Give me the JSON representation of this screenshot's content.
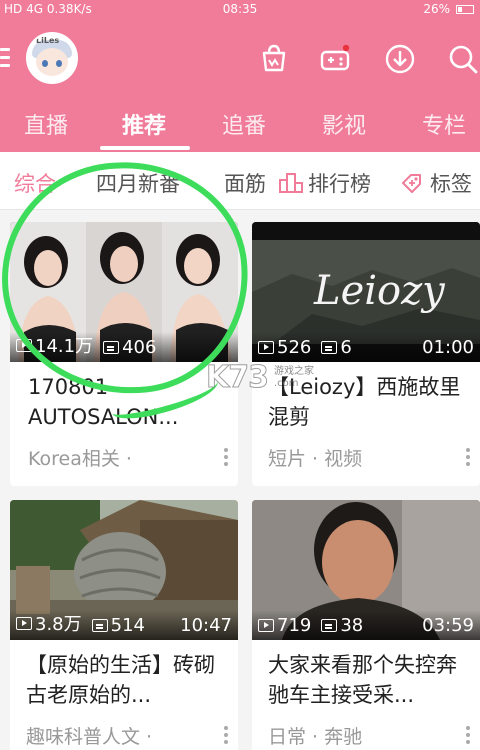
{
  "status_bar": {
    "signal": "HD 4G",
    "speed": "0.38K/s",
    "time": "08:35",
    "battery": "26%"
  },
  "header": {
    "avatar_label": "LiLes",
    "icons": [
      "shop-bag-icon",
      "game-icon",
      "download-icon",
      "search-icon"
    ],
    "accent": "#f07c9a"
  },
  "tabs": [
    {
      "label": "直播",
      "active": false
    },
    {
      "label": "推荐",
      "active": true
    },
    {
      "label": "追番",
      "active": false
    },
    {
      "label": "影视",
      "active": false
    },
    {
      "label": "专栏",
      "active": false
    }
  ],
  "subnav": [
    {
      "label": "综合",
      "active": true
    },
    {
      "label": "四月新番",
      "active": false
    },
    {
      "label": "面筋",
      "active": false
    },
    {
      "label": "排行榜",
      "active": false
    },
    {
      "label": "标签",
      "active": false
    }
  ],
  "videos": [
    {
      "views": "14.1万",
      "danmaku": "406",
      "duration": "",
      "title": "170801 AUTOSALON...",
      "meta": "Korea相关 ·"
    },
    {
      "views": "526",
      "danmaku": "6",
      "duration": "01:00",
      "title": "【Leiozy】西施故里混剪",
      "meta": "短片 · 视频",
      "thumb_text": "Leiozy"
    },
    {
      "views": "3.8万",
      "danmaku": "514",
      "duration": "10:47",
      "title": "【原始的生活】砖砌古老原始的...",
      "meta": "趣味科普人文 ·"
    },
    {
      "views": "719",
      "danmaku": "38",
      "duration": "03:59",
      "title": "大家来看那个失控奔驰车主接受采...",
      "meta": "日常 · 奔驰"
    }
  ],
  "watermark": {
    "logo": "K73",
    "line1": "游戏之家",
    "line2": ".com"
  }
}
